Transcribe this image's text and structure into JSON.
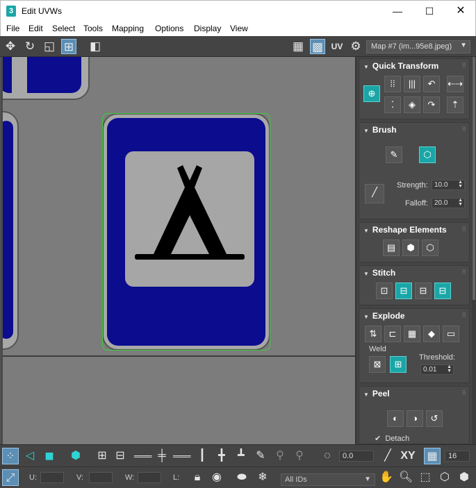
{
  "window": {
    "app_icon_text": "3",
    "title": "Edit UVWs",
    "min_symbol": "—",
    "max_symbol": "☐",
    "close_symbol": "✕"
  },
  "menu": [
    "File",
    "Edit",
    "Select",
    "Tools",
    "Mapping",
    "Options",
    "Display",
    "View"
  ],
  "toolbar": {
    "uv_label": "UV",
    "map_select": "Map #7 (im...95e8.jpeg)",
    "map_select_arrow": "▼"
  },
  "rollouts": {
    "quick_transform": "Quick Transform",
    "brush": "Brush",
    "strength_label": "Strength:",
    "strength_value": "10.0",
    "falloff_label": "Falloff:",
    "falloff_value": "20.0",
    "reshape_elements": "Reshape Elements",
    "stitch": "Stitch",
    "explode": "Explode",
    "weld_label": "Weld",
    "threshold_label": "Threshold:",
    "threshold_value": "0.01",
    "peel": "Peel",
    "detach_label": "Detach",
    "detach_checked": true
  },
  "bottom": {
    "rotation_value": "0.0",
    "xy_label": "XY",
    "grid_value": "16",
    "u_label": "U:",
    "v_label": "V:",
    "w_label": "W:",
    "l_label": "L:",
    "ids_select": "All IDs",
    "ids_select_arrow": "▼"
  },
  "colors": {
    "sign_blue": "#0b0c8e",
    "accent_teal": "#1aa6a6",
    "selection_green": "#3ad13a",
    "active_blue": "#5b8fb5"
  }
}
